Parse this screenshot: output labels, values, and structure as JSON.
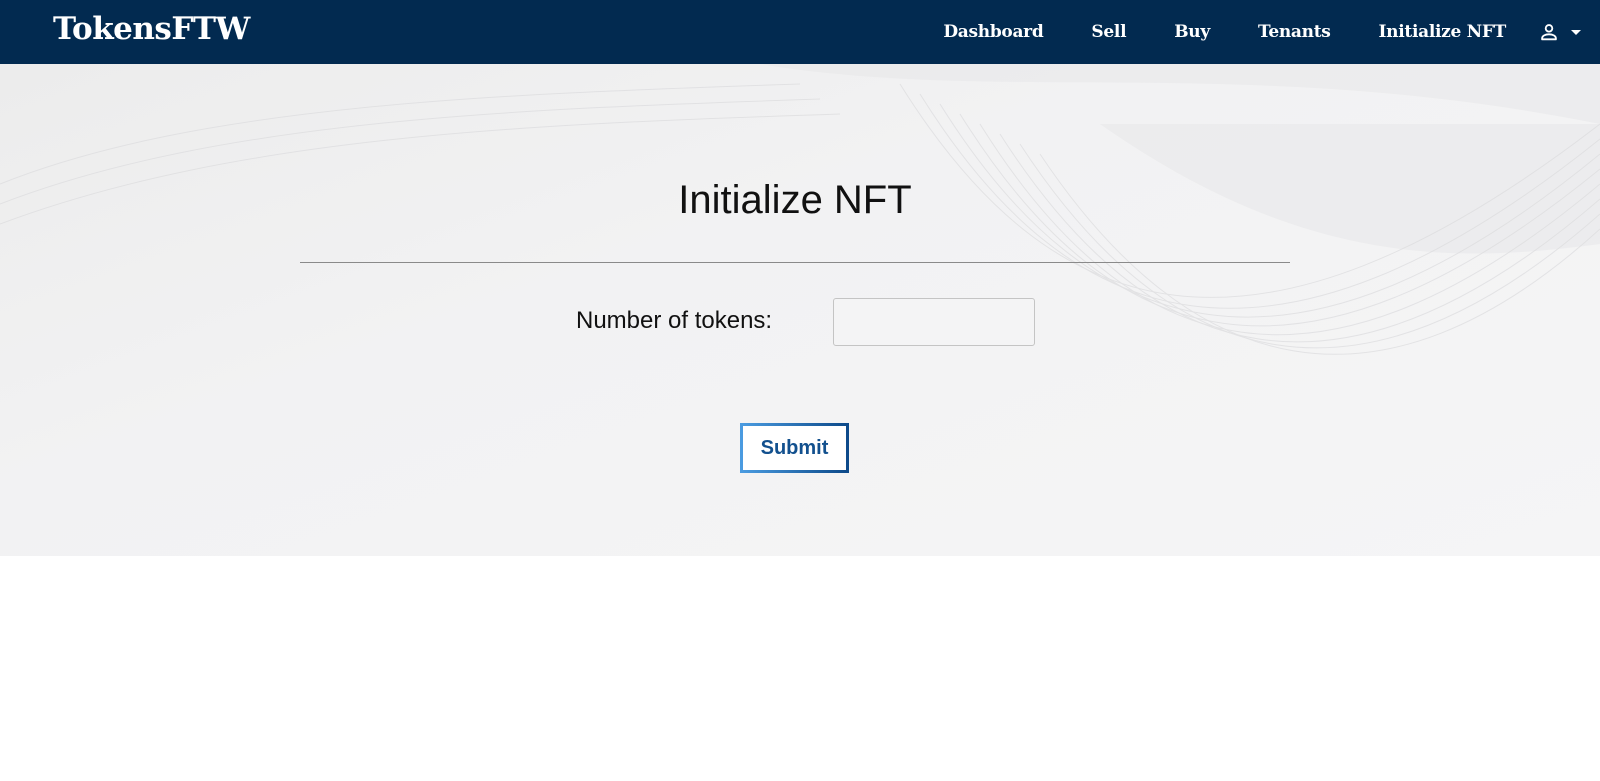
{
  "brand": {
    "name": "TokensFTW"
  },
  "nav": {
    "items": [
      {
        "label": "Dashboard"
      },
      {
        "label": "Sell"
      },
      {
        "label": "Buy"
      },
      {
        "label": "Tenants"
      },
      {
        "label": "Initialize NFT"
      }
    ],
    "user_icon": "person-icon",
    "dropdown_icon": "caret-down-icon"
  },
  "main": {
    "title": "Initialize NFT",
    "form": {
      "tokens_label": "Number of tokens:",
      "tokens_value": "",
      "submit_label": "Submit"
    }
  },
  "colors": {
    "navbar": "#022a50",
    "accent": "#1b5e9e"
  }
}
